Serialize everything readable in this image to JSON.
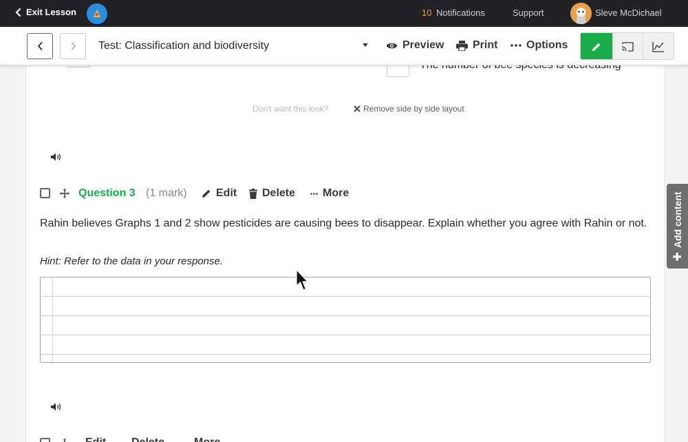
{
  "topbar": {
    "exit_label": "Exit Lesson",
    "notifications_count": "10",
    "notifications_label": "Notifications",
    "support_label": "Support",
    "user_name": "Sleve McDichael"
  },
  "toolbar": {
    "lesson_title": "Test: Classification and biodiversity",
    "preview_label": "Preview",
    "print_label": "Print",
    "options_label": "Options"
  },
  "content": {
    "partial_option_text": "The number of bee species is decreasing",
    "side_by_side_note": "Don't want this look?",
    "remove_layout_label": "Remove side by side layout"
  },
  "question": {
    "title": "Question 3",
    "marks": "(1 mark)",
    "edit_label": "Edit",
    "delete_label": "Delete",
    "more_label": "More",
    "text": "Rahin believes Graphs 1 and 2 show pesticides are causing bees to disappear. Explain whether you agree with Rahin or not.",
    "hint": "Hint: Refer to the data in your response."
  },
  "next_question": {
    "edit_label": "Edit",
    "delete_label": "Delete",
    "more_label": "More"
  },
  "sidebar_tab": {
    "add_content_label": "Add content"
  },
  "colors": {
    "accent_green": "#1aac4c",
    "topbar_bg": "#222226",
    "notification_orange": "#f3a13a"
  }
}
